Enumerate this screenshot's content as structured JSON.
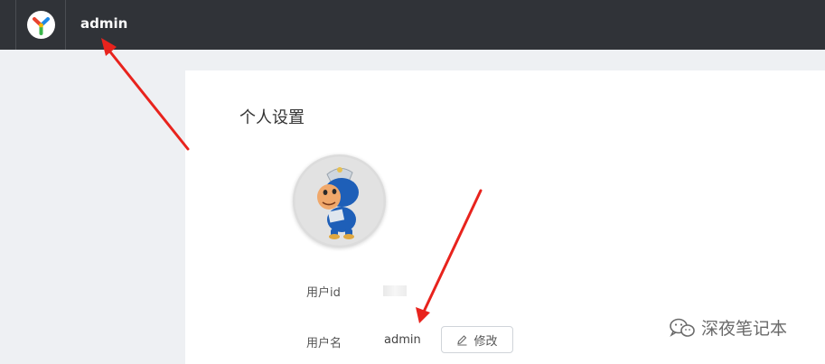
{
  "header": {
    "username": "admin"
  },
  "page": {
    "title": "个人设置"
  },
  "profile": {
    "userid_label": "用户id",
    "username_label": "用户名",
    "username_value": "admin",
    "edit_label": "修改"
  },
  "watermark": {
    "text": "深夜笔记本"
  },
  "colors": {
    "topbar": "#303338",
    "page_bg": "#eef0f3",
    "panel": "#ffffff",
    "arrow": "#e8231d",
    "logo_red": "#e8432e",
    "logo_yellow": "#f5b800",
    "logo_blue": "#1e88e5",
    "logo_green": "#3ab54a"
  }
}
